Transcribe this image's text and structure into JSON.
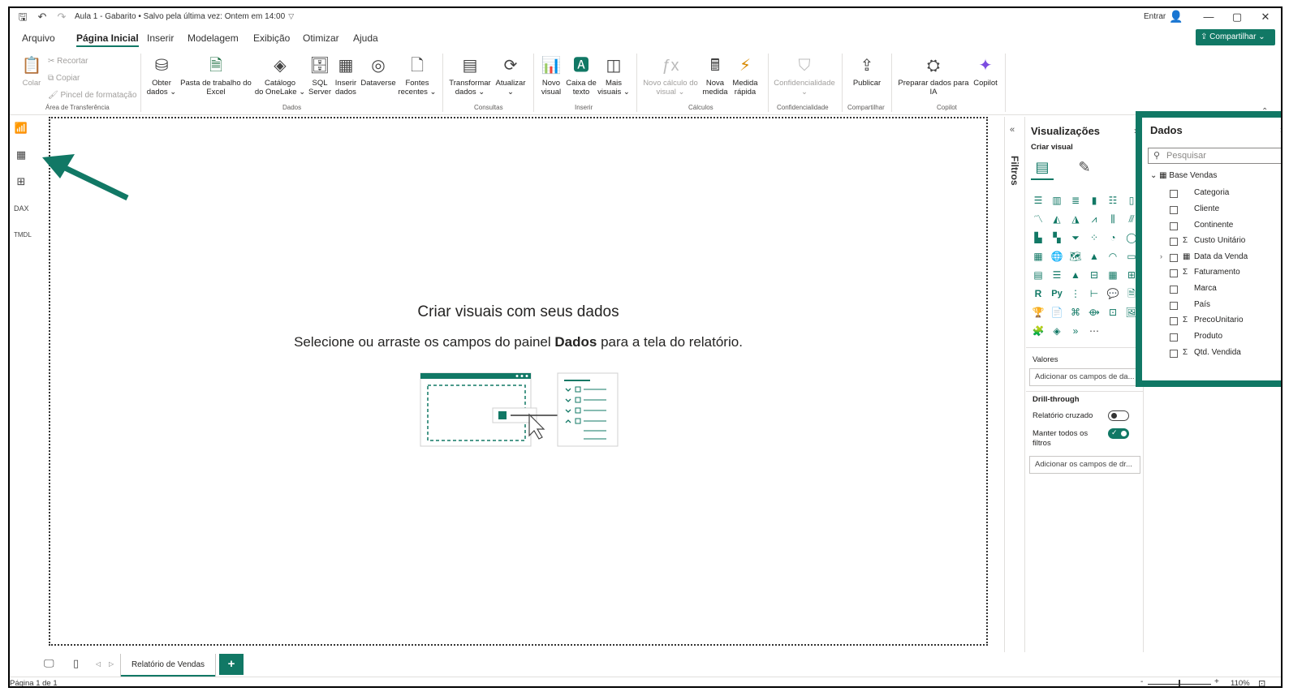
{
  "titlebar": {
    "title": "Aula 1 - Gabarito • Salvo pela última vez: Ontem em 14:00",
    "signin": "Entrar",
    "minimize": "—",
    "maximize": "▢",
    "close": "✕"
  },
  "menu": {
    "items": [
      "Arquivo",
      "Página Inicial",
      "Inserir",
      "Modelagem",
      "Exibição",
      "Otimizar",
      "Ajuda"
    ],
    "share": "Compartilhar"
  },
  "ribbon": {
    "clipboard": {
      "paste": "Colar",
      "cut": "Recortar",
      "copy": "Copiar",
      "format_painter": "Pincel de formatação",
      "group": "Área de Transferência"
    },
    "data": {
      "get_data": [
        "Obter",
        "dados ⌄"
      ],
      "excel": [
        "Pasta de trabalho do",
        "Excel"
      ],
      "onelake": [
        "Catálogo",
        "do OneLake ⌄"
      ],
      "sql": [
        "SQL",
        "Server"
      ],
      "enter_data": [
        "Inserir",
        "dados"
      ],
      "dataverse": [
        "Dataverse",
        ""
      ],
      "recent": [
        "Fontes",
        "recentes ⌄"
      ],
      "group": "Dados"
    },
    "queries": {
      "transform": [
        "Transformar",
        "dados ⌄"
      ],
      "refresh": [
        "Atualizar",
        "⌄"
      ],
      "group": "Consultas"
    },
    "insert": {
      "new_visual": [
        "Novo",
        "visual"
      ],
      "text_box": [
        "Caixa de",
        "texto"
      ],
      "more_visuals": [
        "Mais",
        "visuais ⌄"
      ],
      "group": "Inserir"
    },
    "calculations": {
      "new_calc": [
        "Novo cálculo do",
        "visual ⌄"
      ],
      "new_measure": [
        "Nova",
        "medida"
      ],
      "quick_measure": [
        "Medida",
        "rápida"
      ],
      "group": "Cálculos"
    },
    "sensitivity": {
      "label": [
        "Confidencialidade",
        "⌄"
      ],
      "group": "Confidencialidade"
    },
    "share": {
      "publish": [
        "Publicar",
        ""
      ],
      "group": "Compartilhar"
    },
    "copilot": {
      "prepare": [
        "Preparar dados para",
        "IA"
      ],
      "copilot": [
        "Copilot",
        ""
      ],
      "group": "Copilot"
    }
  },
  "canvas": {
    "title": "Criar visuais com seus dados",
    "subtitle_before": "Selecione ou arraste os campos do painel ",
    "subtitle_bold": "Dados",
    "subtitle_after": " para a tela do relatório."
  },
  "filters": {
    "label": "Filtros"
  },
  "visualizations": {
    "title": "Visualizações",
    "build": "Criar visual",
    "values_label": "Valores",
    "values_placeholder": "Adicionar os campos de da...",
    "drill_title": "Drill-through",
    "cross_report": "Relatório cruzado",
    "cross_report_on": false,
    "keep_filters": "Manter todos os filtros",
    "keep_filters_on": true,
    "drill_placeholder": "Adicionar os campos de dr..."
  },
  "data_pane": {
    "title": "Dados",
    "search_placeholder": "Pesquisar",
    "table": "Base Vendas",
    "fields": [
      {
        "name": "Categoria",
        "sigma": false
      },
      {
        "name": "Cliente",
        "sigma": false
      },
      {
        "name": "Continente",
        "sigma": false
      },
      {
        "name": "Custo Unitário",
        "sigma": true
      },
      {
        "name": "Data da Venda",
        "sigma": false,
        "table_icon": true
      },
      {
        "name": "Faturamento",
        "sigma": true
      },
      {
        "name": "Marca",
        "sigma": false
      },
      {
        "name": "País",
        "sigma": false
      },
      {
        "name": "PrecoUnitario",
        "sigma": true
      },
      {
        "name": "Produto",
        "sigma": false
      },
      {
        "name": "Qtd. Vendida",
        "sigma": true
      }
    ]
  },
  "pages": {
    "active": "Relatório de Vendas",
    "add": "+"
  },
  "status": {
    "page": "Página 1 de 1",
    "zoom": "110%",
    "zoom_minus": "-",
    "zoom_plus": "+"
  },
  "colors": {
    "accent": "#117865",
    "text": "#252423"
  }
}
